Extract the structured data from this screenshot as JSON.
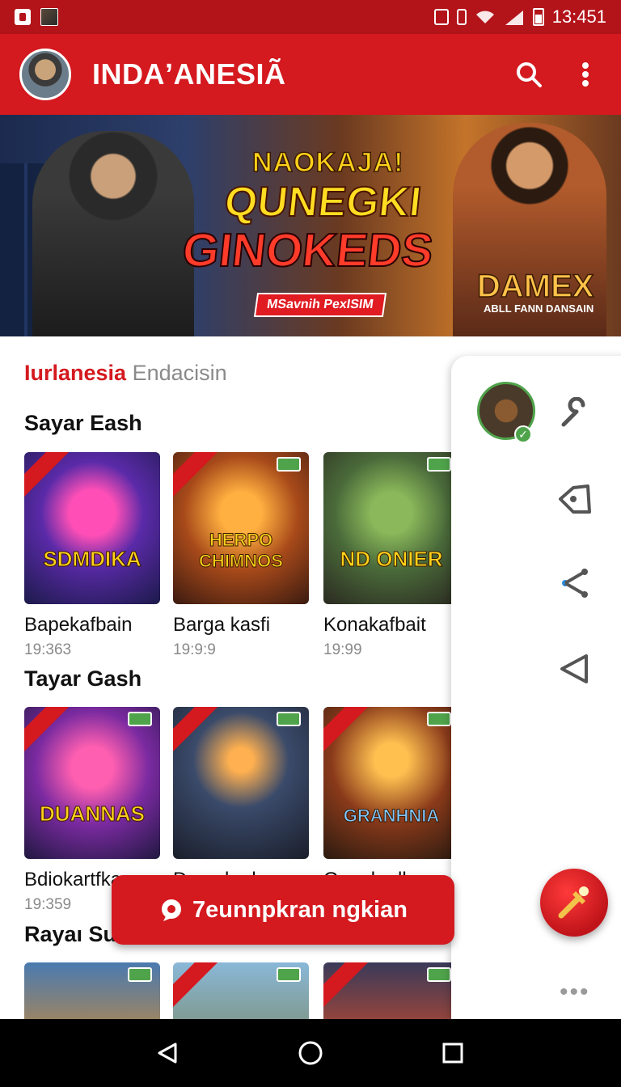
{
  "status_bar": {
    "time": "13:451"
  },
  "app_bar": {
    "title": "INDAʼANESIÃ"
  },
  "banner": {
    "line1": "NAOKAJA!",
    "line2": "QUNEGKI",
    "line3": "GINOKEDS",
    "tag": "MSavnih PexISIM",
    "brand": "DAMEX",
    "brand_sub": "ABLL FANN DANSAIN"
  },
  "brand_row": {
    "accent": "Iurlanesia",
    "muted": "Endacisin"
  },
  "sections": [
    {
      "title": "Sayar Eash",
      "items": [
        {
          "tile_text": "SDMDIKA",
          "title": "Bapekafbain",
          "time": "19:363"
        },
        {
          "tile_text": "HERPO CHIMNOS",
          "title": "Barga kasfi",
          "time": "19:9:9"
        },
        {
          "tile_text": "ND ONIER",
          "title": "Konakafbait",
          "time": "19:99"
        }
      ]
    },
    {
      "title": "Tayar Gash",
      "items": [
        {
          "tile_text": "DUANNAS",
          "title": "Bdiokartfkan",
          "time": "19:359"
        },
        {
          "tile_text": "",
          "title": "Damakarka",
          "time": ""
        },
        {
          "tile_text": "GRANHNIA",
          "title": "Ganakadkan",
          "time": ""
        }
      ]
    },
    {
      "title": "Rayaı Su",
      "items": [
        {},
        {},
        {}
      ]
    }
  ],
  "cta": {
    "label": "7eunnpkran ngkian"
  },
  "side_panel": {
    "more": "•••"
  },
  "colors": {
    "primary": "#d4191f",
    "status_bar": "#b3141a",
    "success": "#4fa34a"
  },
  "icons": [
    "search-icon",
    "more-vert-icon",
    "wrench-icon",
    "tag-icon",
    "share-icon",
    "back-triangle-icon",
    "chat-icon",
    "torch-icon",
    "nav-back-icon",
    "nav-home-icon",
    "nav-recents-icon"
  ]
}
